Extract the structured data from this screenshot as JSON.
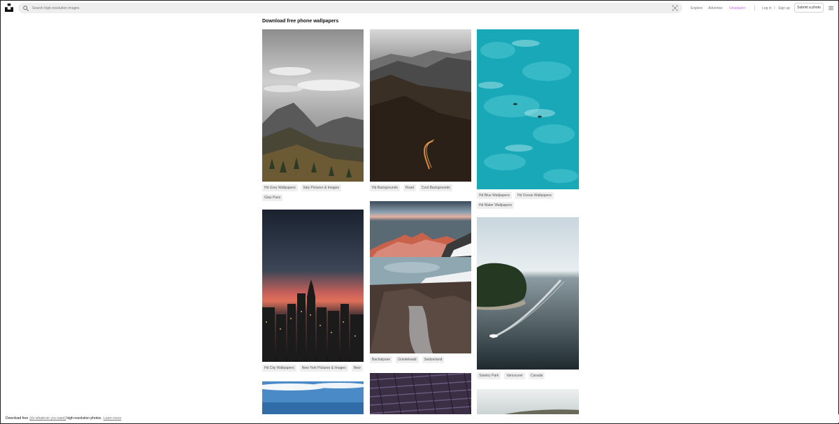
{
  "header": {
    "search_placeholder": "Search high-resolution images",
    "nav": {
      "explore": "Explore",
      "advertise": "Advertise",
      "unsplash_plus": "Unsplash+",
      "login": "Log in",
      "slash": "/",
      "signup": "Sign up",
      "submit": "Submit a photo"
    }
  },
  "page": {
    "title": "Download free phone wallpapers"
  },
  "photos": [
    {
      "tags": [
        "Hd Grey Wallpapers",
        "Italy Pictures & Images",
        "Giau Pass"
      ]
    },
    {
      "tags": [
        "Hd Backgrounds",
        "Road",
        "Cool Backgrounds"
      ]
    },
    {
      "tags": [
        "Hd Blue Wallpapers",
        "Hd Ocean Wallpapers",
        "Hd Water Wallpapers"
      ]
    },
    {
      "tags": [
        "Hd City Wallpapers",
        "New York Pictures & Images",
        "New"
      ]
    },
    {
      "tags": [
        "Bachalpsee",
        "Grindelwald",
        "Switzerland"
      ]
    },
    {
      "tags": [
        "Stanley Park",
        "Vancouver",
        "Canada"
      ]
    }
  ],
  "footer": {
    "prefix": "Download free",
    "link_middle": "(do whatever you want)",
    "suffix": "high-resolution photos.",
    "learn_more": "Learn more"
  },
  "colors": {
    "accent_plus": "#c267ff",
    "tag_bg": "#eeeeee",
    "text_muted": "#767676"
  }
}
